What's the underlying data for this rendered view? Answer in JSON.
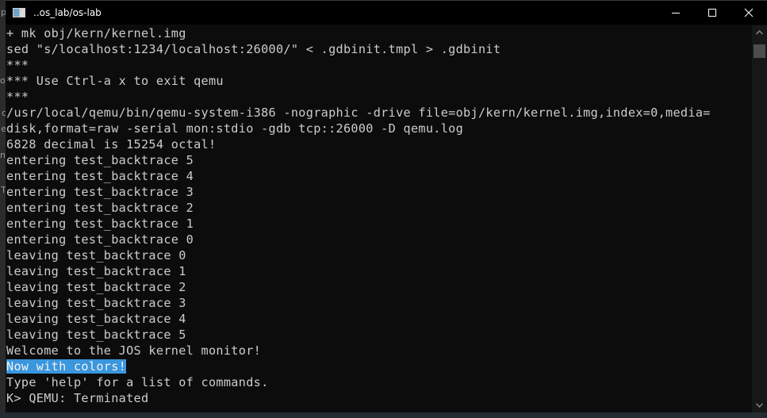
{
  "window": {
    "title": "..os_lab/os-lab",
    "icons": {
      "app": "console-icon",
      "minimize": "minimize-icon",
      "maximize": "maximize-icon",
      "close": "close-icon"
    }
  },
  "background_fragments": [
    "p",
    "of",
    "c",
    "e",
    "ne",
    "T"
  ],
  "terminal": {
    "lines": [
      "+ mk obj/kern/kernel.img",
      "sed \"s/localhost:1234/localhost:26000/\" < .gdbinit.tmpl > .gdbinit",
      "***",
      "*** Use Ctrl-a x to exit qemu",
      "***",
      "/usr/local/qemu/bin/qemu-system-i386 -nographic -drive file=obj/kern/kernel.img,index=0,media=",
      "disk,format=raw -serial mon:stdio -gdb tcp::26000 -D qemu.log",
      "6828 decimal is 15254 octal!",
      "entering test_backtrace 5",
      "entering test_backtrace 4",
      "entering test_backtrace 3",
      "entering test_backtrace 2",
      "entering test_backtrace 1",
      "entering test_backtrace 0",
      "leaving test_backtrace 0",
      "leaving test_backtrace 1",
      "leaving test_backtrace 2",
      "leaving test_backtrace 3",
      "leaving test_backtrace 4",
      "leaving test_backtrace 5",
      "Welcome to the JOS kernel monitor!",
      "Now with colors!",
      "Type 'help' for a list of commands.",
      "K> QEMU: Terminated"
    ],
    "highlighted_line_index": 21,
    "colors": {
      "background": "#0c0c0c",
      "foreground": "#cccccc",
      "highlight": "#3a96dd"
    }
  },
  "scrollbar": {
    "up_icon": "chevron-up-icon",
    "down_icon": "chevron-down-icon",
    "position_fraction": 0.0
  }
}
